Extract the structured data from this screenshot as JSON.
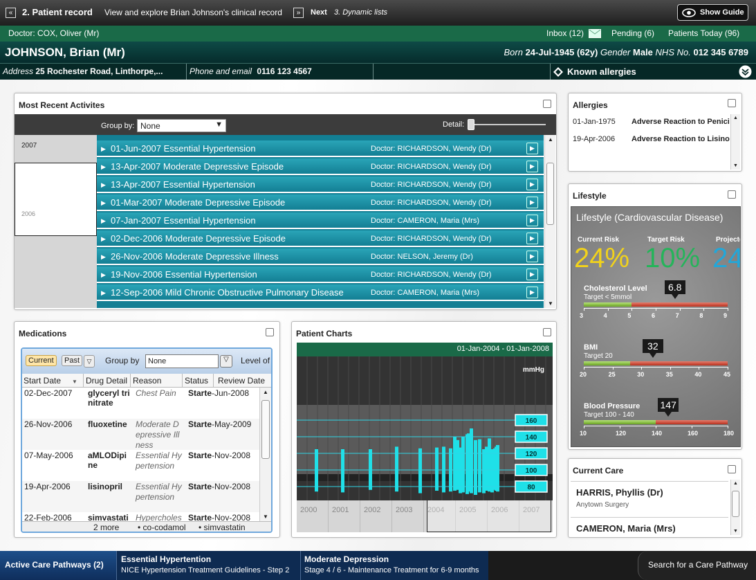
{
  "topbar": {
    "back_icon": "«",
    "step": "2. Patient record",
    "description": "View and explore Brian Johnson's clinical record",
    "next_icon": "»",
    "next": "Next",
    "next_step": "3. Dynamic lists",
    "guide": "Show Guide"
  },
  "docbar": {
    "doctor": "Doctor: COX, Oliver (Mr)",
    "inbox": "Inbox (12)",
    "pending": "Pending (6)",
    "today": "Patients Today (96)"
  },
  "patient": {
    "name": "JOHNSON, Brian (Mr)",
    "born_label": "Born",
    "born": "24-Jul-1945",
    "age": "(62y)",
    "gender_label": "Gender",
    "gender": "Male",
    "nhs_label": "NHS No.",
    "nhs": "012 345 6789"
  },
  "address": {
    "label": "Address",
    "value": "25 Rochester Road, Linthorpe,...",
    "phone_label": "Phone and email",
    "phone": "0116 123 4567",
    "allergies": "Known allergies"
  },
  "activities": {
    "title": "Most Recent Activites",
    "group_label": "Group by:",
    "group_value": "None",
    "detail": "Detail:",
    "year_top": "2007",
    "year_bottom": "2006",
    "rows": [
      {
        "date": "01-Jun-2007",
        "text": "Essential Hypertension",
        "doc": "Doctor: RICHARDSON, Wendy (Dr)"
      },
      {
        "date": "13-Apr-2007",
        "text": "Moderate Depressive Episode",
        "doc": "Doctor: RICHARDSON, Wendy (Dr)"
      },
      {
        "date": "13-Apr-2007",
        "text": "Essential Hypertension",
        "doc": "Doctor: RICHARDSON, Wendy (Dr)"
      },
      {
        "date": "01-Mar-2007",
        "text": "Moderate Depressive Episode",
        "doc": "Doctor: RICHARDSON, Wendy (Dr)"
      },
      {
        "date": "07-Jan-2007",
        "text": "Essential Hypertension",
        "doc": "Doctor: CAMERON, Maria (Mrs)"
      },
      {
        "date": "02-Dec-2006",
        "text": "Moderate Depressive Episode",
        "doc": "Doctor: RICHARDSON, Wendy (Dr)"
      },
      {
        "date": "26-Nov-2006",
        "text": "Moderate Depressive Illness",
        "doc": "Doctor: NELSON, Jeremy (Dr)"
      },
      {
        "date": "19-Nov-2006",
        "text": "Essential Hypertension",
        "doc": "Doctor: RICHARDSON, Wendy (Dr)"
      },
      {
        "date": "12-Sep-2006",
        "text": "Mild Chronic Obstructive Pulmonary Disease",
        "doc": "Doctor: CAMERON, Maria (Mrs)"
      }
    ]
  },
  "allergies": {
    "title": "Allergies",
    "rows": [
      {
        "date": "01-Jan-1975",
        "text": "Adverse Reaction to Penici"
      },
      {
        "date": "19-Apr-2006",
        "text": "Adverse Reaction to Lisino"
      }
    ]
  },
  "lifestyle": {
    "title": "Lifestyle",
    "inner_title": "Lifestyle (Cardiovascular Disease)",
    "current_label": "Current Risk",
    "current": "24%",
    "target_label": "Target Risk",
    "target": "10%",
    "projected_label": "Projecte",
    "projected": "24",
    "gauges": [
      {
        "name": "Cholesterol Level",
        "target": "Target < 5mmol",
        "value": "6.8",
        "v": 6.8,
        "min": 3,
        "max": 9,
        "good": 5,
        "ticks": [
          "3",
          "4",
          "5",
          "6",
          "7",
          "8",
          "9"
        ]
      },
      {
        "name": "BMI",
        "target": "Target 20",
        "value": "32",
        "v": 32,
        "min": 20,
        "max": 45,
        "good": 28,
        "ticks": [
          "20",
          "25",
          "30",
          "35",
          "40",
          "45"
        ]
      },
      {
        "name": "Blood Pressure",
        "target": "Target 100 - 140",
        "value": "147",
        "v": 147,
        "min": 100,
        "max": 180,
        "good": 140,
        "ticks": [
          "10",
          "120",
          "140",
          "160",
          "180"
        ]
      }
    ]
  },
  "medications": {
    "title": "Medications",
    "current": "Current",
    "past": "Past",
    "group_label": "Group by",
    "group_value": "None",
    "level": "Level of",
    "columns": [
      "Start Date",
      "Drug Detail",
      "Reason",
      "Status",
      "Review Date"
    ],
    "rows": [
      {
        "date": "02-Dec-2007",
        "drug": "glyceryl trinitrate",
        "reason": "Chest Pain",
        "status": "Starte",
        "review": "-Jun-2008"
      },
      {
        "date": "26-Nov-2006",
        "drug": "fluoxetine",
        "reason": "Moderate Depressive Illness",
        "status": "Starte",
        "review": "-May-2009"
      },
      {
        "date": "07-May-2006",
        "drug": "aMLODipine",
        "reason": "Essential Hypertension",
        "status": "Starte",
        "review": "-Nov-2008"
      },
      {
        "date": "19-Apr-2006",
        "drug": "lisinopril",
        "reason": "Essential Hypertension",
        "status": "Starte",
        "review": "-Nov-2008"
      },
      {
        "date": "22-Feb-2006",
        "drug": "simvastatin",
        "reason": "Hypercholesterolaemia",
        "status": "Starte",
        "review": "-Nov-2008"
      }
    ],
    "more": "2 more",
    "extra1": "co-codamol",
    "extra2": "simvastatin"
  },
  "patient_charts": {
    "title": "Patient Charts",
    "range": "01-Jan-2004 - 01-Jan-2008",
    "unit": "mmHg",
    "levels": [
      "160",
      "140",
      "120",
      "100",
      "80"
    ],
    "years": [
      "2000",
      "2001",
      "2002",
      "2003",
      "2004",
      "2005",
      "2006",
      "2007"
    ]
  },
  "care": {
    "title": "Current Care",
    "p1": "HARRIS, Phyllis (Dr)",
    "p1_sub": "Anytown Surgery",
    "p2": "CAMERON, Maria (Mrs)"
  },
  "bottom": {
    "pathways": "Active Care Pathways (2)",
    "p1_title": "Essential Hypertention",
    "p1_sub": "NICE Hypertension Treatment Guidelines - Step 2",
    "p2_title": "Moderate Depression",
    "p2_sub": "Stage 4 / 6 - Maintenance Treatment for 6-9 months",
    "search": "Search for a Care Pathway"
  },
  "chart_data": {
    "type": "bar",
    "title": "",
    "ylabel": "mmHg",
    "ylim": [
      70,
      170
    ],
    "series": [
      {
        "values": [
          [
            74,
            125
          ],
          [
            73,
            125
          ],
          [
            76,
            125
          ],
          [
            74,
            128
          ],
          [
            72,
            126
          ],
          [
            75,
            127
          ],
          [
            73,
            128
          ],
          [
            74,
            126
          ],
          [
            75,
            140
          ],
          [
            76,
            136
          ],
          [
            72,
            127
          ],
          [
            73,
            140
          ],
          [
            71,
            143
          ],
          [
            74,
            144
          ],
          [
            72,
            150
          ],
          [
            70,
            136
          ],
          [
            73,
            137
          ],
          [
            72,
            125
          ],
          [
            75,
            128
          ],
          [
            74,
            138
          ],
          [
            73,
            125
          ],
          [
            76,
            126
          ],
          [
            75,
            128
          ],
          [
            74,
            130
          ]
        ]
      }
    ]
  }
}
